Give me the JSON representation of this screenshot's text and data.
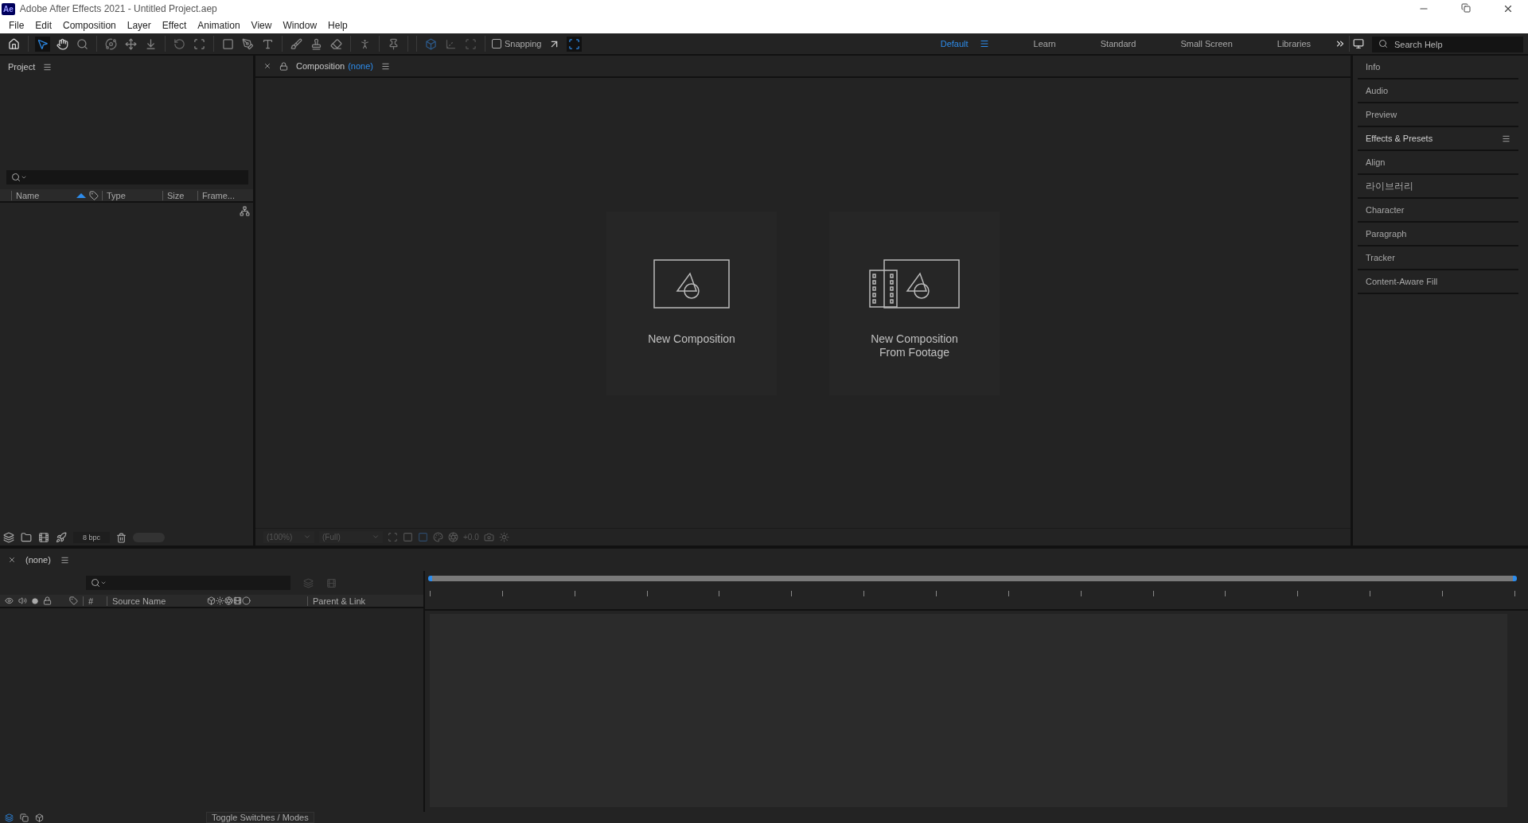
{
  "window": {
    "title": "Adobe After Effects 2021 - Untitled Project.aep",
    "app_badge": "Ae"
  },
  "menu": [
    "File",
    "Edit",
    "Composition",
    "Layer",
    "Effect",
    "Animation",
    "View",
    "Window",
    "Help"
  ],
  "toolbar": {
    "snapping": {
      "label": "Snapping",
      "checked": false
    }
  },
  "workspaces": [
    {
      "label": "Default",
      "selected": true
    },
    {
      "label": "Learn",
      "selected": false
    },
    {
      "label": "Standard",
      "selected": false
    },
    {
      "label": "Small Screen",
      "selected": false
    },
    {
      "label": "Libraries",
      "selected": false
    }
  ],
  "search_help": {
    "placeholder": "Search Help"
  },
  "project_panel": {
    "title": "Project",
    "columns": [
      "Name",
      "Type",
      "Size",
      "Frame..."
    ],
    "bit_depth": "8 bpc"
  },
  "composition_panel": {
    "title": "Composition",
    "comp_name": "(none)",
    "zoom": "(100%)",
    "resolution": "(Full)",
    "exposure": "+0.0",
    "cards": [
      {
        "kind": "new",
        "lines": [
          "New Composition"
        ]
      },
      {
        "kind": "footage",
        "lines": [
          "New Composition",
          "From Footage"
        ]
      }
    ]
  },
  "right_panels": [
    {
      "label": "Info",
      "menu": false
    },
    {
      "label": "Audio",
      "menu": false
    },
    {
      "label": "Preview",
      "menu": false
    },
    {
      "label": "Effects & Presets",
      "menu": true
    },
    {
      "label": "Align",
      "menu": false
    },
    {
      "label": "라이브러리",
      "menu": false
    },
    {
      "label": "Character",
      "menu": false
    },
    {
      "label": "Paragraph",
      "menu": false
    },
    {
      "label": "Tracker",
      "menu": false
    },
    {
      "label": "Content-Aware Fill",
      "menu": false
    }
  ],
  "timeline": {
    "tab": "(none)",
    "columns": [
      "#",
      "Source Name",
      "Parent & Link"
    ],
    "toggle_label": "Toggle Switches / Modes"
  }
}
